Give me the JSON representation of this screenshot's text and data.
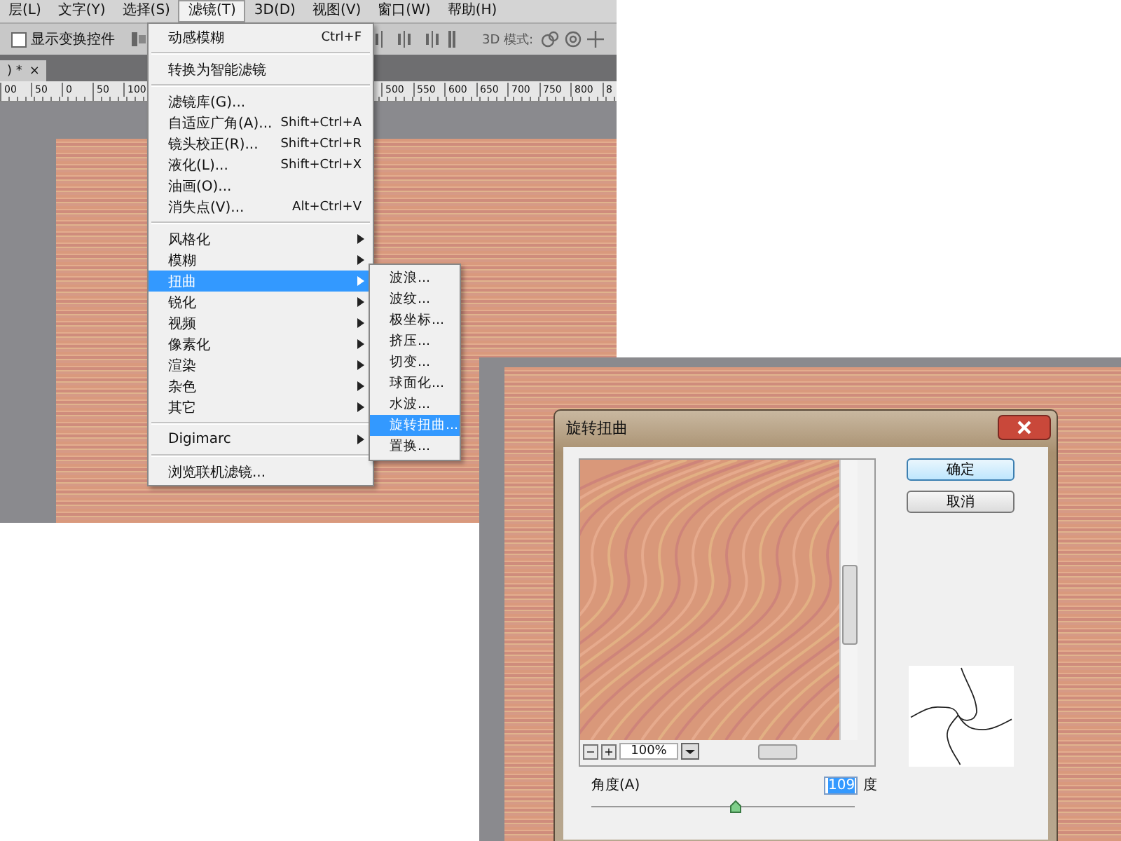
{
  "photoshop": {
    "menubar": [
      {
        "label": "层(L)",
        "selected": false
      },
      {
        "label": "文字(Y)",
        "selected": false
      },
      {
        "label": "选择(S)",
        "selected": false
      },
      {
        "label": "滤镜(T)",
        "selected": true
      },
      {
        "label": "3D(D)",
        "selected": false
      },
      {
        "label": "视图(V)",
        "selected": false
      },
      {
        "label": "窗口(W)",
        "selected": false
      },
      {
        "label": "帮助(H)",
        "selected": false
      }
    ],
    "options_bar": {
      "show_transform": {
        "label": "显示变换控件",
        "checked": false
      },
      "mode_label": "3D 模式:"
    },
    "document_tab": {
      "title": ") *",
      "close": "×"
    },
    "ruler": [
      "00",
      "50",
      "0",
      "50",
      "100",
      "500",
      "550",
      "600",
      "650",
      "700",
      "750",
      "800",
      "8"
    ],
    "filter_menu": [
      {
        "kind": "item",
        "label": "动感模糊",
        "shortcut": "Ctrl+F",
        "submenu": false,
        "selected": false
      },
      {
        "kind": "separator"
      },
      {
        "kind": "item",
        "label": "转换为智能滤镜",
        "submenu": false,
        "selected": false
      },
      {
        "kind": "separator"
      },
      {
        "kind": "item",
        "label": "滤镜库(G)...",
        "submenu": false,
        "selected": false
      },
      {
        "kind": "item",
        "label": "自适应广角(A)...",
        "shortcut": "Shift+Ctrl+A",
        "submenu": false,
        "selected": false
      },
      {
        "kind": "item",
        "label": "镜头校正(R)...",
        "shortcut": "Shift+Ctrl+R",
        "submenu": false,
        "selected": false
      },
      {
        "kind": "item",
        "label": "液化(L)...",
        "shortcut": "Shift+Ctrl+X",
        "submenu": false,
        "selected": false
      },
      {
        "kind": "item",
        "label": "油画(O)...",
        "submenu": false,
        "selected": false
      },
      {
        "kind": "item",
        "label": "消失点(V)...",
        "shortcut": "Alt+Ctrl+V",
        "submenu": false,
        "selected": false
      },
      {
        "kind": "separator"
      },
      {
        "kind": "item",
        "label": "风格化",
        "submenu": true,
        "selected": false
      },
      {
        "kind": "item",
        "label": "模糊",
        "submenu": true,
        "selected": false
      },
      {
        "kind": "item",
        "label": "扭曲",
        "submenu": true,
        "selected": true
      },
      {
        "kind": "item",
        "label": "锐化",
        "submenu": true,
        "selected": false
      },
      {
        "kind": "item",
        "label": "视频",
        "submenu": true,
        "selected": false
      },
      {
        "kind": "item",
        "label": "像素化",
        "submenu": true,
        "selected": false
      },
      {
        "kind": "item",
        "label": "渲染",
        "submenu": true,
        "selected": false
      },
      {
        "kind": "item",
        "label": "杂色",
        "submenu": true,
        "selected": false
      },
      {
        "kind": "item",
        "label": "其它",
        "submenu": true,
        "selected": false
      },
      {
        "kind": "separator"
      },
      {
        "kind": "item",
        "label": "Digimarc",
        "submenu": true,
        "selected": false
      },
      {
        "kind": "separator"
      },
      {
        "kind": "item",
        "label": "浏览联机滤镜...",
        "submenu": false,
        "selected": false
      }
    ],
    "distort_submenu": [
      {
        "label": "波浪...",
        "selected": false
      },
      {
        "label": "波纹...",
        "selected": false
      },
      {
        "label": "极坐标...",
        "selected": false
      },
      {
        "label": "挤压...",
        "selected": false
      },
      {
        "label": "切变...",
        "selected": false
      },
      {
        "label": "球面化...",
        "selected": false
      },
      {
        "label": "水波...",
        "selected": false
      },
      {
        "label": "旋转扭曲...",
        "selected": true
      },
      {
        "label": "置换...",
        "selected": false
      }
    ]
  },
  "twirl_dialog": {
    "title": "旋转扭曲",
    "ok": "确定",
    "cancel": "取消",
    "zoom": "100%",
    "zoom_out": "−",
    "zoom_in": "+",
    "angle": {
      "label": "角度(A)",
      "value": "109",
      "unit": "度",
      "level": 0.55
    }
  }
}
